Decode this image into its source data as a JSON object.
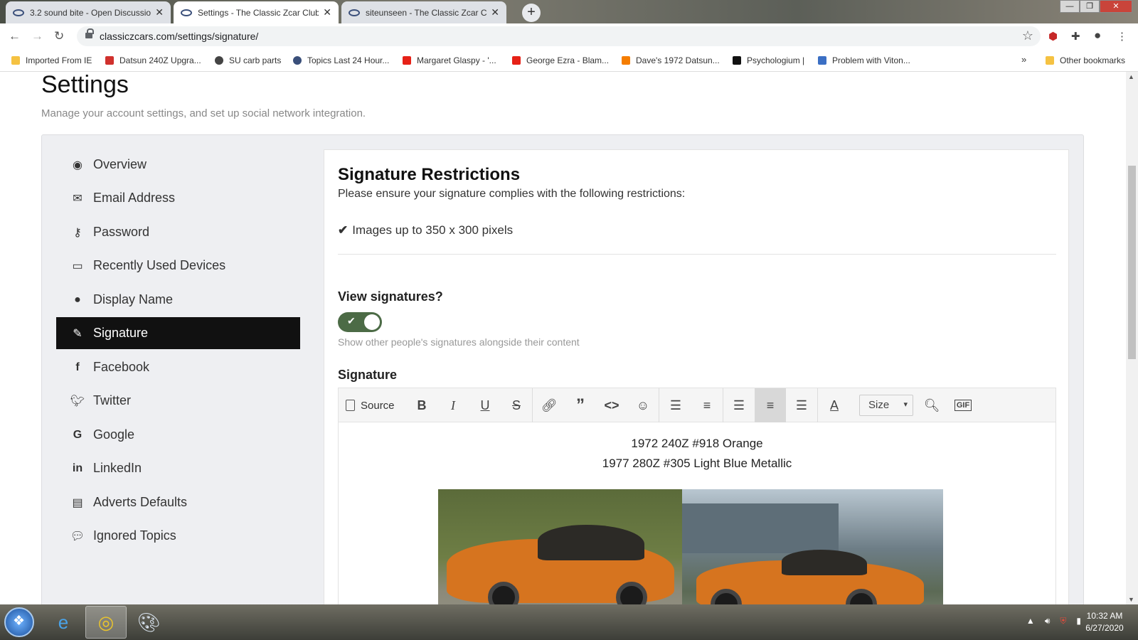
{
  "browser": {
    "tabs": [
      {
        "title": "3.2 sound bite - Open Discussion",
        "active": false
      },
      {
        "title": "Settings - The Classic Zcar Club",
        "active": true
      },
      {
        "title": "siteunseen - The Classic Zcar Club",
        "active": false
      }
    ],
    "new_tab": "+",
    "window": {
      "minimize": "—",
      "maximize": "❐",
      "close": "✕"
    },
    "url": "classiczcars.com/settings/signature/",
    "bookmarks": [
      {
        "label": "Imported From IE",
        "icon": "folder-icon",
        "color": "#f5c242"
      },
      {
        "label": "Datsun 240Z Upgra...",
        "icon": "z-logo-icon",
        "color": "#d0312d"
      },
      {
        "label": "SU carb parts",
        "icon": "globe-icon",
        "color": "#444444"
      },
      {
        "label": "Topics Last 24 Hour...",
        "icon": "zcar-logo-icon",
        "color": "#3a4f7a"
      },
      {
        "label": "Margaret Glaspy - '...",
        "icon": "youtube-icon",
        "color": "#e62117"
      },
      {
        "label": "George Ezra - Blam...",
        "icon": "youtube-icon",
        "color": "#e62117"
      },
      {
        "label": "Dave's 1972 Datsun...",
        "icon": "blogger-icon",
        "color": "#f57d00"
      },
      {
        "label": "Psychologium |",
        "icon": "p-logo-icon",
        "color": "#111111"
      },
      {
        "label": "Problem with Viton...",
        "icon": "check-logo-icon",
        "color": "#3b6fc4"
      }
    ],
    "more": "»",
    "other_bookmarks": "Other bookmarks"
  },
  "page": {
    "title": "Settings",
    "subtitle": "Manage your account settings, and set up social network integration."
  },
  "sidebar": {
    "items": [
      {
        "label": "Overview",
        "icon": "dashboard-icon",
        "active": false
      },
      {
        "label": "Email Address",
        "icon": "envelope-icon",
        "active": false
      },
      {
        "label": "Password",
        "icon": "key-icon",
        "active": false
      },
      {
        "label": "Recently Used Devices",
        "icon": "laptop-icon",
        "active": false
      },
      {
        "label": "Display Name",
        "icon": "user-icon",
        "active": false
      },
      {
        "label": "Signature",
        "icon": "pencil-icon",
        "active": true
      },
      {
        "label": "Facebook",
        "icon": "facebook-icon",
        "active": false
      },
      {
        "label": "Twitter",
        "icon": "twitter-icon",
        "active": false
      },
      {
        "label": "Google",
        "icon": "google-icon",
        "active": false
      },
      {
        "label": "LinkedIn",
        "icon": "linkedin-icon",
        "active": false
      },
      {
        "label": "Adverts Defaults",
        "icon": "newspaper-icon",
        "active": false
      },
      {
        "label": "Ignored Topics",
        "icon": "comments-icon",
        "active": false
      }
    ]
  },
  "signature": {
    "restrictions_title": "Signature Restrictions",
    "restrictions_intro": "Please ensure your signature complies with the following restrictions:",
    "restriction_items": [
      "Images up to 350 x 300 pixels"
    ],
    "view_label": "View signatures?",
    "view_toggle_on": true,
    "view_help": "Show other people's signatures alongside their content",
    "editor_label": "Signature",
    "toolbar": {
      "source": "Source",
      "size": "Size"
    },
    "content_lines": [
      "1972 240Z #918 Orange",
      "1977 280Z #305 Light Blue Metallic"
    ]
  },
  "taskbar": {
    "time": "10:32 AM",
    "date": "6/27/2020"
  },
  "colors": {
    "toggle_on": "#4c6b46",
    "sidebar_active": "#111111",
    "car_orange": "#d6741f"
  }
}
